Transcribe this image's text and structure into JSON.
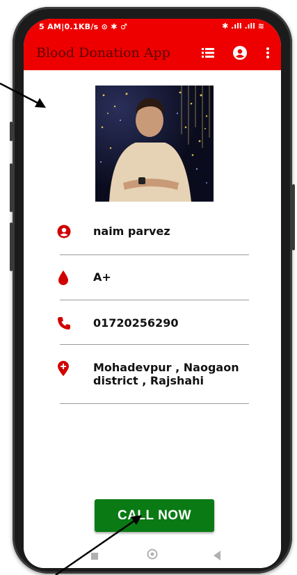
{
  "status_bar": {
    "left_text": "5 AM|0.1KB/s ⊙ ✱ ♂",
    "right_text": "✱ .ıll .ıll ≋"
  },
  "app_bar": {
    "title": "Blood Donation App"
  },
  "profile": {
    "name": "naim parvez",
    "blood_group": "A+",
    "phone": "01720256290",
    "address_line1": "Mohadevpur , Naogaon",
    "address_line2": "district , Rajshahi"
  },
  "actions": {
    "call_now_label": "CALL NOW"
  },
  "colors": {
    "accent": "#ee0000",
    "icon_red": "#d00000",
    "button_green": "#0a7a14"
  },
  "icons": [
    "list-icon",
    "account-icon",
    "more-vert-icon",
    "person-icon",
    "blood-drop-icon",
    "phone-icon",
    "location-pin-icon",
    "nav-back-icon",
    "nav-home-icon",
    "nav-recents-icon"
  ]
}
